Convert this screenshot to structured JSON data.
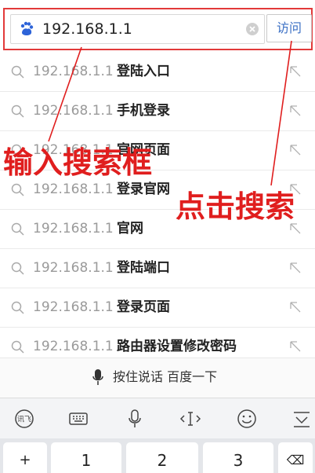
{
  "search": {
    "value": "192.168.1.1",
    "visit_label": "访问"
  },
  "suggestions": [
    {
      "ip": "192.168.1.1",
      "suffix": "登陆入口"
    },
    {
      "ip": "192.168.1.1",
      "suffix": "手机登录"
    },
    {
      "ip": "192.168.1.1",
      "suffix": "官网页面"
    },
    {
      "ip": "192.168.1.1",
      "suffix": "登录官网"
    },
    {
      "ip": "192.168.1.1",
      "suffix": "官网"
    },
    {
      "ip": "192.168.1.1",
      "suffix": "登陆端口"
    },
    {
      "ip": "192.168.1.1",
      "suffix": "登录页面"
    },
    {
      "ip": "192.168.1.1",
      "suffix": "路由器设置修改密码"
    }
  ],
  "voice": {
    "label": "按住说话 百度一下"
  },
  "keyboard": {
    "toolbar_icons": [
      "ime-logo-icon",
      "keyboard-icon",
      "mic-icon",
      "cursor-icon",
      "emoji-icon",
      "collapse-icon"
    ],
    "keys": [
      "+",
      "1",
      "2",
      "3",
      "⌫"
    ]
  },
  "annotations": {
    "input_box_label": "输入搜索框",
    "click_search_label": "点击搜索",
    "color": "#e01e1e"
  }
}
